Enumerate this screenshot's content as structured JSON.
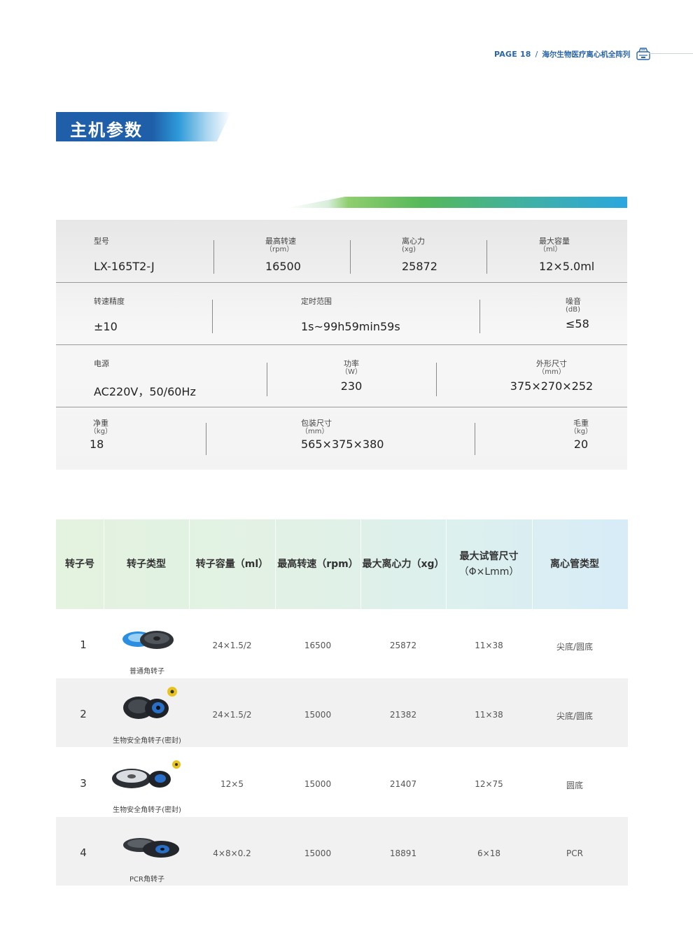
{
  "header": {
    "page": "PAGE 18",
    "separator": "/",
    "series": "海尔生物医疗离心机全阵列",
    "icon": "centrifuge-icon"
  },
  "section_title": "主机参数",
  "specs": {
    "row1": [
      {
        "label": "型号",
        "unit": "",
        "value": "LX-165T2-J"
      },
      {
        "label": "最高转速",
        "unit": "（rpm）",
        "value": "16500"
      },
      {
        "label": "离心力",
        "unit": "(xg)",
        "value": "25872"
      },
      {
        "label": "最大容量",
        "unit": "（ml）",
        "value": "12×5.0ml"
      }
    ],
    "row2": [
      {
        "label": "转速精度",
        "unit": "",
        "value": "±10"
      },
      {
        "label": "定时范围",
        "unit": "",
        "value": "1s~99h59min59s"
      },
      {
        "label": "噪音",
        "unit": "(dB)",
        "value": "≤58"
      }
    ],
    "row3": [
      {
        "label": "电源",
        "unit": "",
        "value": "AC220V，50/60Hz"
      },
      {
        "label": "功率",
        "unit": "（W）",
        "value": "230"
      },
      {
        "label": "外形尺寸",
        "unit": "（mm）",
        "value": "375×270×252"
      }
    ],
    "row4": [
      {
        "label": "净重",
        "unit": "（kg）",
        "value": "18"
      },
      {
        "label": "包装尺寸",
        "unit": "（mm）",
        "value": "565×375×380"
      },
      {
        "label": "毛重",
        "unit": "（kg）",
        "value": "20"
      }
    ]
  },
  "rotor_table": {
    "headers": [
      "转子号",
      "转子类型",
      "转子容量（ml）",
      "最高转速（rpm）",
      "最大离心力（xg）",
      "最大试管尺寸",
      "（Φ×Lmm）",
      "离心管类型"
    ],
    "rows": [
      {
        "no": "1",
        "type": "普通角转子",
        "capacity": "24×1.5/2",
        "speed": "16500",
        "force": "25872",
        "tube_size": "11×38",
        "tube_type": "尖底/圆底"
      },
      {
        "no": "2",
        "type": "生物安全角转子(密封)",
        "capacity": "24×1.5/2",
        "speed": "15000",
        "force": "21382",
        "tube_size": "11×38",
        "tube_type": "尖底/圆底"
      },
      {
        "no": "3",
        "type": "生物安全角转子(密封)",
        "capacity": "12×5",
        "speed": "15000",
        "force": "21407",
        "tube_size": "12×75",
        "tube_type": "圆底"
      },
      {
        "no": "4",
        "type": "PCR角转子",
        "capacity": "4×8×0.2",
        "speed": "15000",
        "force": "18891",
        "tube_size": "6×18",
        "tube_type": "PCR"
      }
    ]
  },
  "colors": {
    "brand_blue": "#1f5ea9",
    "header_text": "#2a65a8",
    "accent_green": "#55b85a",
    "accent_cyan": "#2ba6df",
    "biohazard": "#e8c320"
  }
}
